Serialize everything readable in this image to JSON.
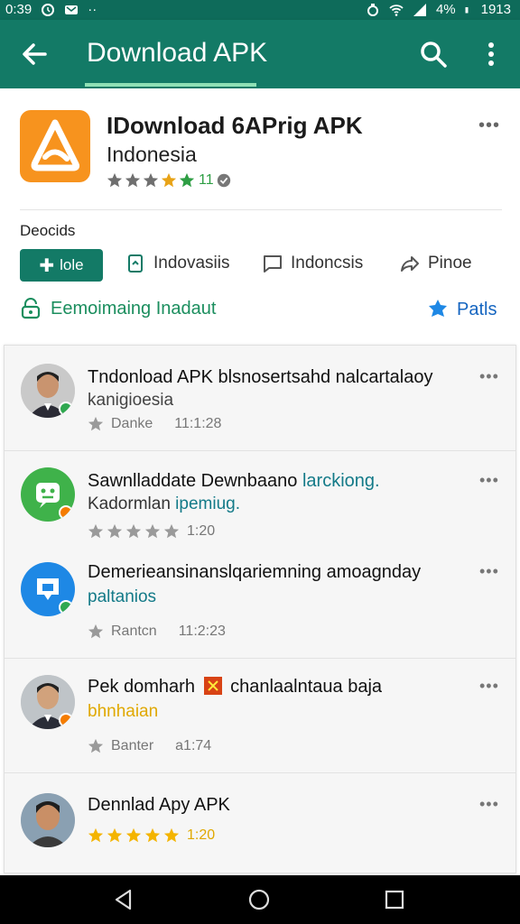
{
  "status_bar": {
    "time": "0:39",
    "battery": "4%",
    "clock": "1913"
  },
  "toolbar": {
    "title": "Download APK"
  },
  "app": {
    "name": "IDownload 6APrig APK",
    "subtitle": "Indonesia",
    "rating_text": "11",
    "rating_stars": 4,
    "section_label": "Deocids",
    "chip_primary": "lole",
    "chip_1": "Indovasiis",
    "chip_2": "Indoncsis",
    "chip_3": "Pinoe",
    "install_label": "Eemoimaing Inadaut",
    "patls_label": "Patls"
  },
  "items": [
    {
      "title": "Tndonload APK blsnosertsahd nalcartalaoy",
      "subtitle": "kanigioesia",
      "meta_label": "Danke",
      "meta_time": "11:1:28",
      "stars": 1
    },
    {
      "title_a": "Sawnlladdate Dewnbaano",
      "title_b": "larckiong.",
      "subtitle_a": "Kadormlan",
      "subtitle_b": "ipemiug.",
      "meta_time": "1:20",
      "stars": 5
    },
    {
      "title": "Demerieansinanslqariemning amoagnday",
      "subtitle": "paltanios",
      "meta_label": "Rantcn",
      "meta_time": "11:2:23",
      "stars": 1
    },
    {
      "title_a": "Pek domharh",
      "title_b": "chanlaalntaua baja",
      "subtitle": "bhnhaian",
      "meta_label": "Banter",
      "meta_time": "a1:74",
      "stars": 1
    },
    {
      "title": "Dennlad Apy APK",
      "meta_time": "1:20",
      "stars": 5
    }
  ],
  "colors": {
    "toolbar": "#137a66",
    "accent_green": "#1b8e5e",
    "accent_blue": "#1565c0",
    "star_gold": "#f4b400"
  }
}
